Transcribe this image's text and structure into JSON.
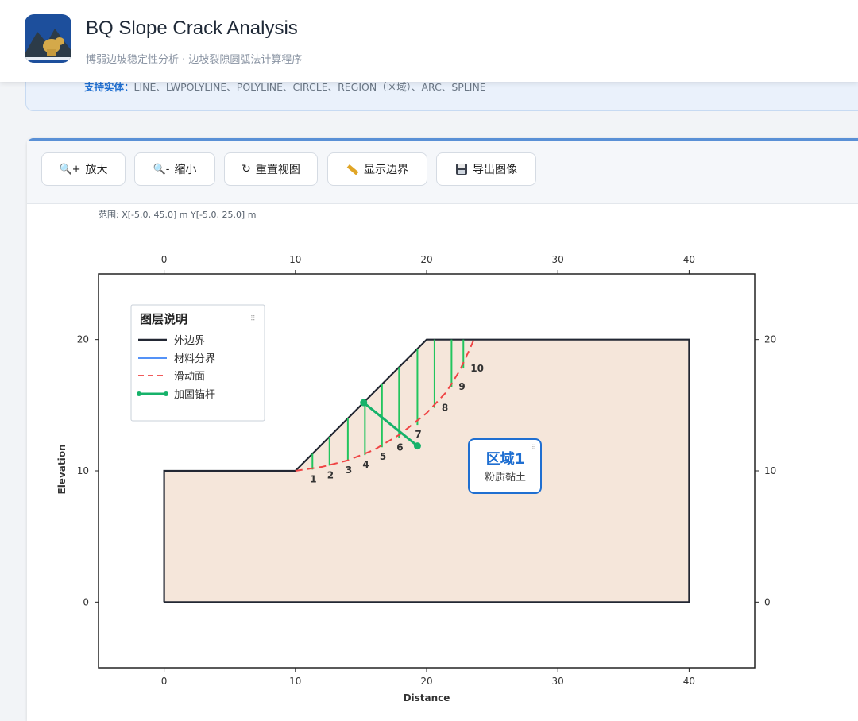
{
  "app": {
    "title": "BQ Slope Crack Analysis",
    "subtitle": "博弱边坡稳定性分析 · 边坡裂隙圆弧法计算程序",
    "logo_icon": "mountain-dog-logo"
  },
  "info": {
    "supported_label": "支持实体：",
    "supported_entities": "LINE、LWPOLYLINE、POLYLINE、CIRCLE、REGION（区域）、ARC、SPLINE"
  },
  "toolbar": {
    "zoom_in": "放大",
    "zoom_out": "缩小",
    "reset": "重置视图",
    "show_boundary": "显示边界",
    "export": "导出图像"
  },
  "colors": {
    "accent": "#1f6fd1",
    "boundary": "#222733",
    "material": "#3b82f6",
    "slip": "#ef4444",
    "anchor": "#16b26a",
    "crack": "#22c55e",
    "soil": "#f5e6da"
  },
  "range_text": "范围: X[-5.0, 45.0] m  Y[-5.0, 25.0] m",
  "legend": {
    "title": "图层说明",
    "items": [
      "外边界",
      "材料分界",
      "滑动面",
      "加固锚杆"
    ]
  },
  "region": {
    "name": "区域1",
    "material": "粉质黏土"
  },
  "chart_data": {
    "type": "line",
    "xlabel": "Distance",
    "ylabel": "Elevation",
    "xlim": [
      -5,
      45
    ],
    "ylim": [
      -5,
      25
    ],
    "xticks": [
      0,
      10,
      20,
      30,
      40
    ],
    "yticks": [
      0,
      10,
      20
    ],
    "boundary": [
      [
        0,
        0
      ],
      [
        40,
        0
      ],
      [
        40,
        20
      ],
      [
        20,
        20
      ],
      [
        10,
        10
      ],
      [
        0,
        10
      ],
      [
        0,
        0
      ]
    ],
    "slip_surface": [
      [
        10,
        10
      ],
      [
        12,
        10.3
      ],
      [
        14,
        10.8
      ],
      [
        16,
        11.6
      ],
      [
        18,
        12.8
      ],
      [
        20,
        14.4
      ],
      [
        21.5,
        16.0
      ],
      [
        22.5,
        17.6
      ],
      [
        23.3,
        19.3
      ],
      [
        23.6,
        20
      ]
    ],
    "cracks": [
      {
        "label": "1",
        "x": 11.3,
        "top": 11.3,
        "bottom": 10.1
      },
      {
        "label": "2",
        "x": 12.6,
        "top": 12.6,
        "bottom": 10.4
      },
      {
        "label": "3",
        "x": 14.0,
        "top": 14.0,
        "bottom": 10.8
      },
      {
        "label": "4",
        "x": 15.3,
        "top": 15.3,
        "bottom": 11.2
      },
      {
        "label": "5",
        "x": 16.6,
        "top": 16.6,
        "bottom": 11.8
      },
      {
        "label": "6",
        "x": 17.9,
        "top": 17.9,
        "bottom": 12.5
      },
      {
        "label": "7",
        "x": 19.3,
        "top": 19.3,
        "bottom": 13.5
      },
      {
        "label": "8",
        "x": 20.6,
        "top": 20.0,
        "bottom": 14.8
      },
      {
        "label": "9",
        "x": 21.9,
        "top": 20.0,
        "bottom": 16.4
      },
      {
        "label": "10",
        "x": 22.8,
        "top": 20.0,
        "bottom": 17.8
      }
    ],
    "anchor": {
      "x1": 15.2,
      "y1": 15.2,
      "x2": 19.3,
      "y2": 11.9
    }
  }
}
